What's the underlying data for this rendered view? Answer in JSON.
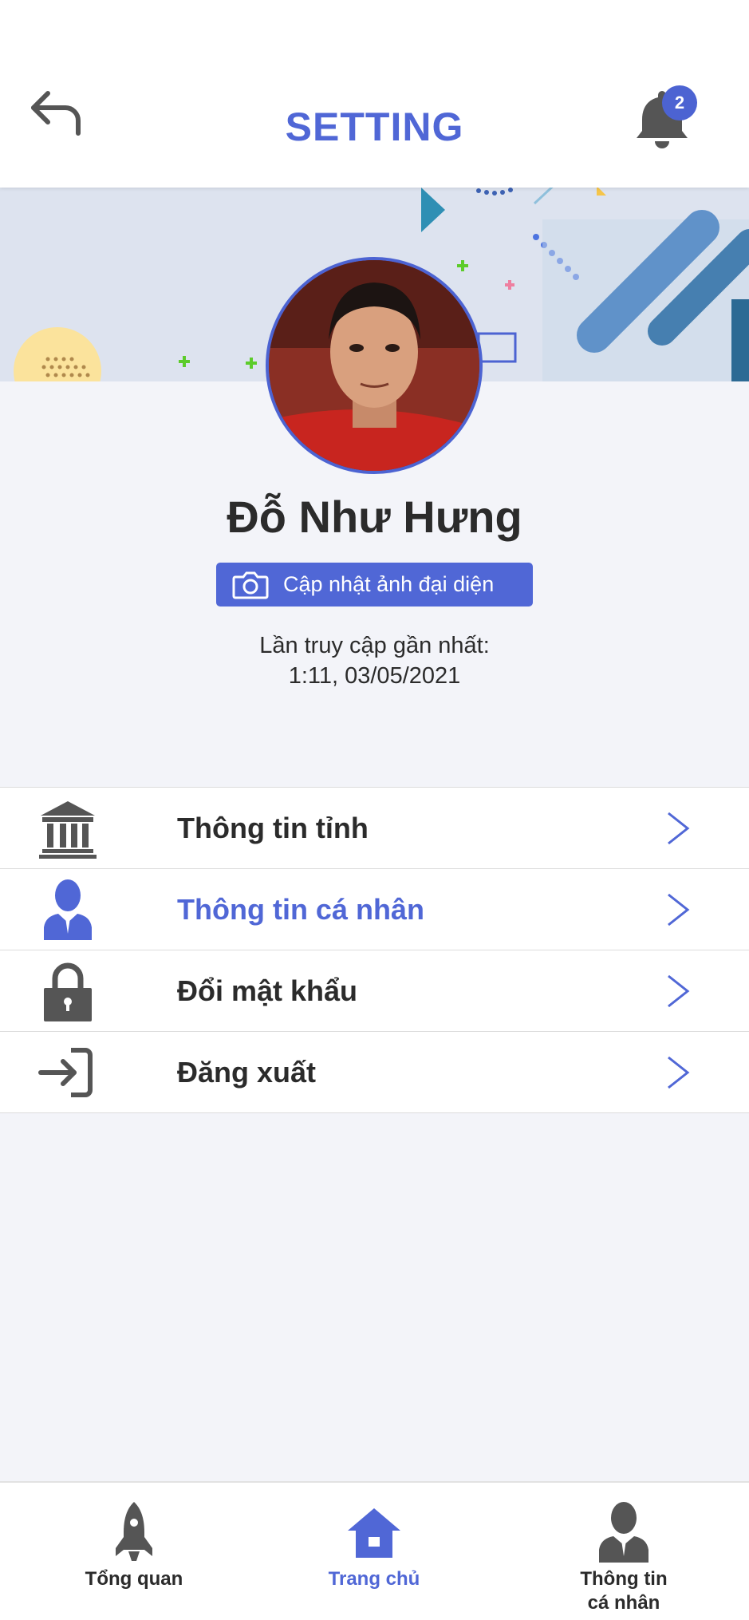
{
  "header": {
    "title": "SETTING",
    "notification_count": "2"
  },
  "profile": {
    "name": "Đỗ Như Hưng",
    "upload_avatar_label": "Cập nhật ảnh đại diện",
    "last_access_label": "Lần truy cập gần nhất:",
    "last_access_value": "1:11, 03/05/2021"
  },
  "menu": {
    "items": [
      {
        "label": "Thông tin tỉnh",
        "icon": "building-icon"
      },
      {
        "label": "Thông tin cá nhân",
        "icon": "user-icon",
        "active": true
      },
      {
        "label": "Đổi mật khẩu",
        "icon": "lock-icon"
      },
      {
        "label": "Đăng xuất",
        "icon": "logout-icon"
      }
    ]
  },
  "bottom_nav": {
    "items": [
      {
        "label": "Tổng quan",
        "icon": "rocket-icon"
      },
      {
        "label": "Trang chủ",
        "icon": "home-icon",
        "active": true
      },
      {
        "label_line1": "Thông tin",
        "label_line2": "cá nhân",
        "icon": "user-icon"
      }
    ]
  },
  "colors": {
    "accent": "#5067d6",
    "text": "#2b2b2b",
    "background": "#f3f4f9",
    "icon_gray": "#555555"
  }
}
